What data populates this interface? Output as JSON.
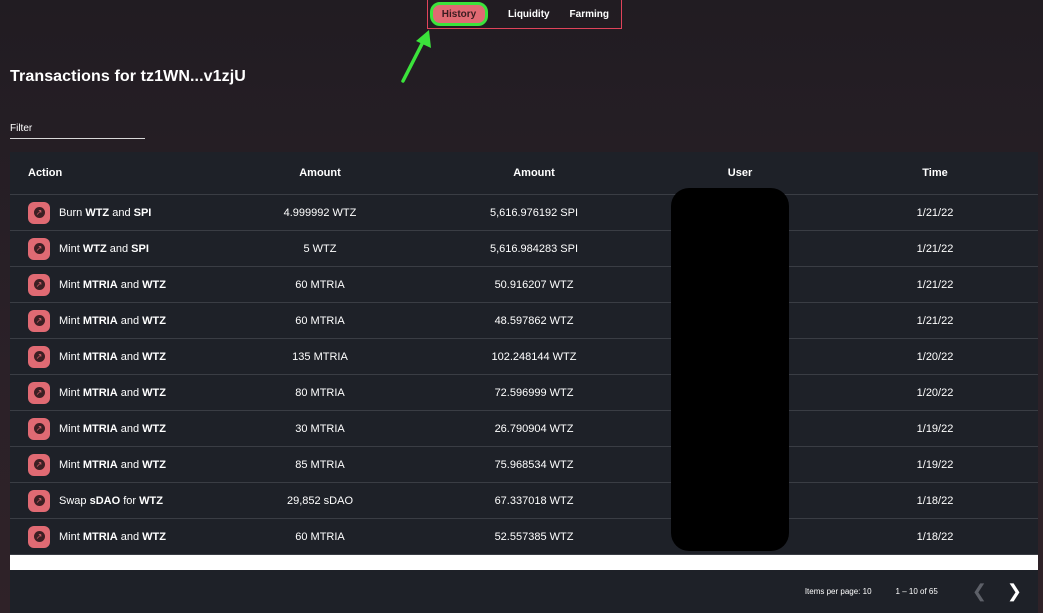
{
  "nav": {
    "tabs": [
      {
        "label": "History",
        "active": true
      },
      {
        "label": "Liquidity",
        "active": false
      },
      {
        "label": "Farming",
        "active": false
      }
    ]
  },
  "page_title": "Transactions for tz1WN...v1zjU",
  "filter": {
    "label": "Filter"
  },
  "table": {
    "headers": [
      "Action",
      "Amount",
      "Amount",
      "User",
      "Time"
    ],
    "rows": [
      {
        "verb": "Burn",
        "a": "WTZ",
        "conj": "and",
        "b": "SPI",
        "amount1": "4.999992 WTZ",
        "amount2": "5,616.976192 SPI",
        "time": "1/21/22"
      },
      {
        "verb": "Mint",
        "a": "WTZ",
        "conj": "and",
        "b": "SPI",
        "amount1": "5 WTZ",
        "amount2": "5,616.984283 SPI",
        "time": "1/21/22"
      },
      {
        "verb": "Mint",
        "a": "MTRIA",
        "conj": "and",
        "b": "WTZ",
        "amount1": "60 MTRIA",
        "amount2": "50.916207 WTZ",
        "time": "1/21/22"
      },
      {
        "verb": "Mint",
        "a": "MTRIA",
        "conj": "and",
        "b": "WTZ",
        "amount1": "60 MTRIA",
        "amount2": "48.597862 WTZ",
        "time": "1/21/22"
      },
      {
        "verb": "Mint",
        "a": "MTRIA",
        "conj": "and",
        "b": "WTZ",
        "amount1": "135 MTRIA",
        "amount2": "102.248144 WTZ",
        "time": "1/20/22"
      },
      {
        "verb": "Mint",
        "a": "MTRIA",
        "conj": "and",
        "b": "WTZ",
        "amount1": "80 MTRIA",
        "amount2": "72.596999 WTZ",
        "time": "1/20/22"
      },
      {
        "verb": "Mint",
        "a": "MTRIA",
        "conj": "and",
        "b": "WTZ",
        "amount1": "30 MTRIA",
        "amount2": "26.790904 WTZ",
        "time": "1/19/22"
      },
      {
        "verb": "Mint",
        "a": "MTRIA",
        "conj": "and",
        "b": "WTZ",
        "amount1": "85 MTRIA",
        "amount2": "75.968534 WTZ",
        "time": "1/19/22"
      },
      {
        "verb": "Swap",
        "a": "sDAO",
        "conj": "for",
        "b": "WTZ",
        "amount1": "29,852 sDAO",
        "amount2": "67.337018 WTZ",
        "time": "1/18/22"
      },
      {
        "verb": "Mint",
        "a": "MTRIA",
        "conj": "and",
        "b": "WTZ",
        "amount1": "60 MTRIA",
        "amount2": "52.557385 WTZ",
        "time": "1/18/22"
      }
    ]
  },
  "pagination": {
    "items_per_page_label": "Items per page:",
    "items_per_page_value": "10",
    "range": "1 – 10 of 65",
    "prev_icon": "chevron-left-icon",
    "next_icon": "chevron-right-icon"
  },
  "colors": {
    "accent": "#e06a73",
    "highlight": "#3be33b",
    "table_bg": "#1e2128"
  }
}
